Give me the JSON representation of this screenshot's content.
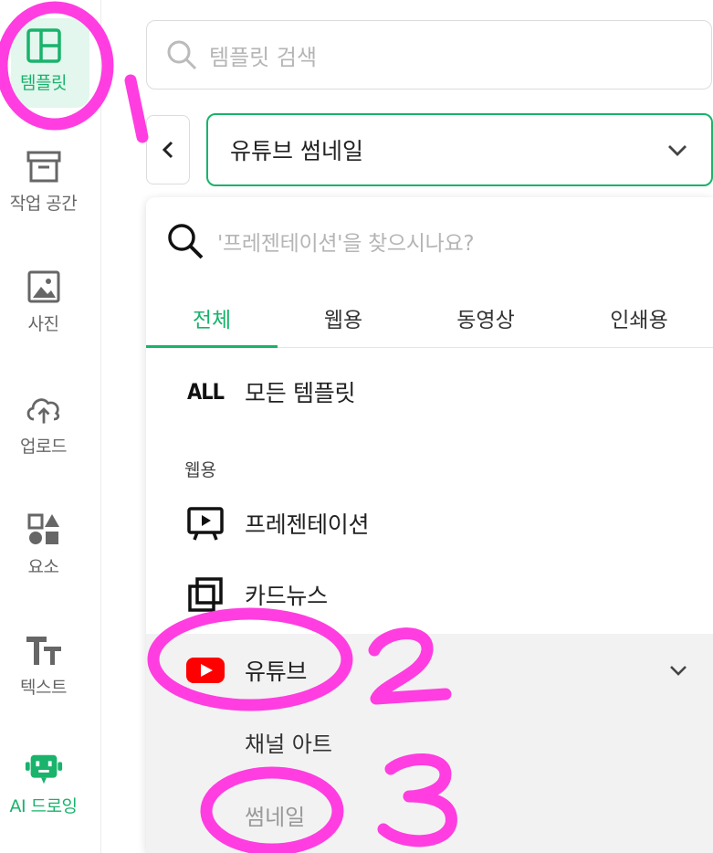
{
  "sidebar": {
    "items": [
      {
        "label": "템플릿",
        "icon": "template-icon",
        "active": true
      },
      {
        "label": "작업 공간",
        "icon": "archive-box-icon"
      },
      {
        "label": "사진",
        "icon": "image-icon"
      },
      {
        "label": "업로드",
        "icon": "cloud-upload-icon"
      },
      {
        "label": "요소",
        "icon": "shapes-icon"
      },
      {
        "label": "텍스트",
        "icon": "text-tt-icon"
      },
      {
        "label": "AI 드로잉",
        "icon": "robot-icon"
      }
    ]
  },
  "search": {
    "placeholder": "템플릿 검색"
  },
  "category_select": {
    "value": "유튜브 썸네일"
  },
  "panel": {
    "search_placeholder": "'프레젠테이션'을 찾으시나요?",
    "tabs": [
      {
        "label": "전체",
        "active": true
      },
      {
        "label": "웹용"
      },
      {
        "label": "동영상"
      },
      {
        "label": "인쇄용"
      }
    ],
    "all_logo": "ALL",
    "all_label": "모든 템플릿",
    "section_label": "웹용",
    "items": [
      {
        "label": "프레젠테이션",
        "icon": "presentation-icon"
      },
      {
        "label": "카드뉴스",
        "icon": "card-news-icon"
      },
      {
        "label": "유튜브",
        "icon": "youtube-icon",
        "expanded": true
      }
    ],
    "sub_items": [
      {
        "label": "채널 아트"
      },
      {
        "label": "썸네일"
      }
    ]
  },
  "colors": {
    "accent": "#19b36b",
    "youtube_red": "#ff0000",
    "annotation_pink": "#ff3de0"
  }
}
